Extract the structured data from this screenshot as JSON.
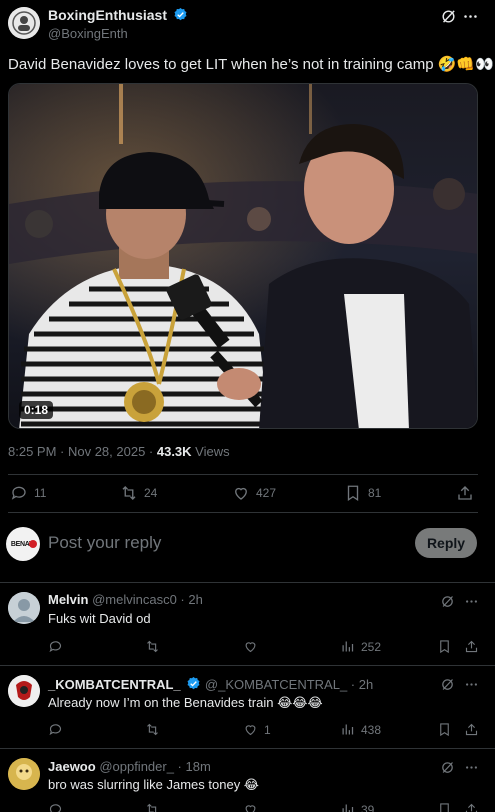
{
  "post": {
    "author_name": "BoxingEnthusiast",
    "author_handle": "@BoxingEnth",
    "text": "David Benavidez loves to get LIT when he’s not in training camp 🤣👊👀",
    "video_duration": "0:18",
    "time": "8:25 PM · Nov 28, 2025 · ",
    "views_count": "43.3K",
    "views_label": " Views",
    "stats": {
      "replies": "11",
      "reposts": "24",
      "likes": "427",
      "bookmarks": "81"
    }
  },
  "composer": {
    "avatar_text": "BENAVI",
    "placeholder": "Post your reply",
    "reply_button": "Reply"
  },
  "replies": [
    {
      "name": "Melvin",
      "handle": "@melvincasc0 · 2h",
      "text": "Fuks wit David od",
      "views": "252",
      "likes": ""
    },
    {
      "name": "_KOMBATCENTRAL_",
      "handle": "@_KOMBATCENTRAL_ · 2h",
      "text": "Already now I’m on the Benavides train 😂😂😂",
      "views": "438",
      "likes": "1"
    },
    {
      "name": "Jaewoo",
      "handle": "@oppfinder_ · 18m",
      "text": "bro was slurring like James toney 😂",
      "views": "39",
      "likes": ""
    }
  ],
  "colors": {
    "accent": "#1d9bf0",
    "muted": "#71767b",
    "divider": "#2f3336",
    "reply_button_bg": "#787a7a"
  },
  "icons": [
    "grok-icon",
    "more-icon",
    "reply-icon",
    "repost-icon",
    "like-icon",
    "bookmark-icon",
    "share-icon",
    "views-icon",
    "verified-icon"
  ]
}
